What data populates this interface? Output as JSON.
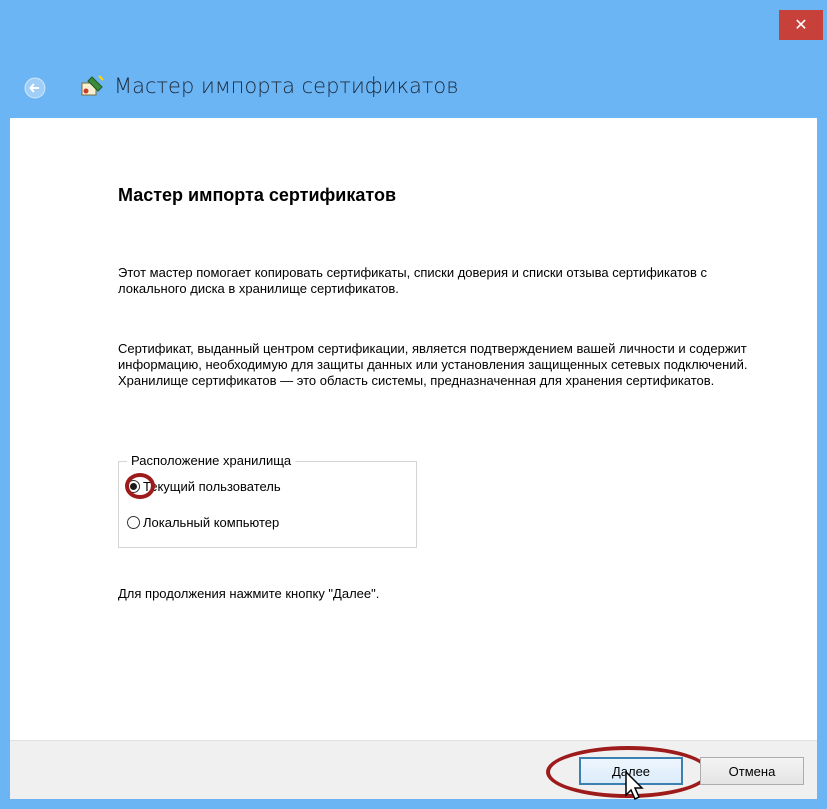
{
  "window": {
    "title": "Мастер импорта сертификатов",
    "close_glyph": "✕"
  },
  "content": {
    "heading": "Мастер импорта сертификатов",
    "paragraph1": "Этот мастер помогает копировать сертификаты, списки доверия и списки отзыва сертификатов с локального диска в хранилище сертификатов.",
    "paragraph2": "Сертификат, выданный центром сертификации, является подтверждением вашей личности и содержит информацию, необходимую для защиты данных или установления защищенных сетевых подключений. Хранилище сертификатов — это область системы, предназначенная для хранения сертификатов.",
    "store_location": {
      "legend": "Расположение хранилища",
      "options": [
        {
          "label": "Текущий пользователь",
          "checked": true
        },
        {
          "label": "Локальный компьютер",
          "checked": false
        }
      ]
    },
    "continue_hint": "Для продолжения нажмите кнопку \"Далее\"."
  },
  "footer": {
    "next_label": "Далее",
    "cancel_label": "Отмена"
  },
  "colors": {
    "chrome": "#6cb5f5",
    "close": "#c7413a",
    "highlight": "#9e1b1b"
  },
  "icons": [
    "close-icon",
    "back-arrow-icon",
    "certificate-wizard-icon",
    "mouse-cursor-icon"
  ]
}
